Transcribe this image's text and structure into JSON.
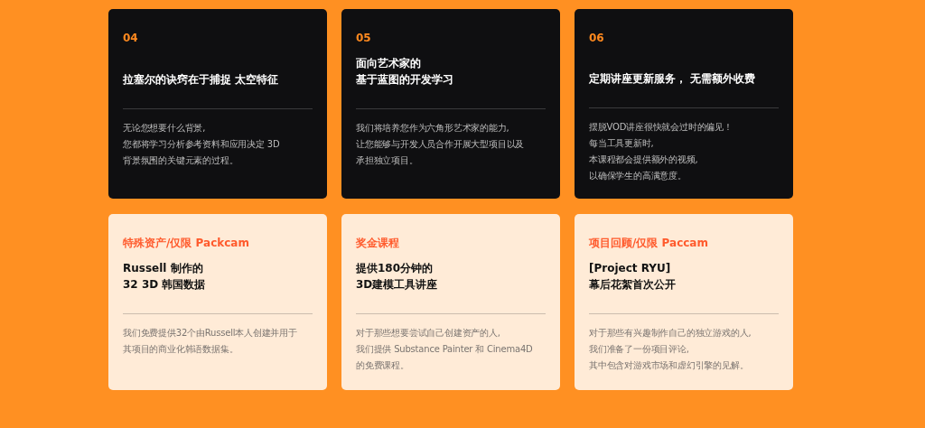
{
  "cards": [
    {
      "kind": "dark",
      "label": "04",
      "title": [
        "拉塞尔的诀窍在于捕捉 太空特征"
      ],
      "description": [
        "无论您想要什么背景,",
        "您都将学习分析参考资料和应用决定 3D",
        "背景氛围的关键元素的过程。"
      ]
    },
    {
      "kind": "dark",
      "label": "05",
      "title": [
        "面向艺术家的",
        "基于蓝图的开发学习"
      ],
      "description": [
        "我们将培养您作为六角形艺术家的能力,",
        "让您能够与开发人员合作开展大型项目以及",
        "承担独立项目。"
      ]
    },
    {
      "kind": "dark",
      "label": "06",
      "title": [
        "定期讲座更新服务， 无需额外收费"
      ],
      "description": [
        "摆脱VOD讲座很快就会过时的偏见！",
        "每当工具更新时,",
        "本课程都会提供额外的视频,",
        "以确保学生的高满意度。"
      ]
    },
    {
      "kind": "light",
      "label": "特殊资产/仅限 Packcam",
      "title": [
        "Russell 制作的",
        "32 3D 韩国数据"
      ],
      "description": [
        "我们免费提供32个由Russell本人创建并用于",
        "其项目的商业化韩语数据集。"
      ]
    },
    {
      "kind": "light",
      "label": "奖金课程",
      "title": [
        "提供180分钟的",
        "3D建模工具讲座"
      ],
      "description": [
        "对于那些想要尝试自己创建资产的人,",
        "我们提供 Substance Painter 和 Cinema4D",
        "的免费课程。"
      ]
    },
    {
      "kind": "light",
      "label": "项目回顾/仅限 Paccam",
      "title": [
        "[Project RYU]",
        "幕后花絮首次公开"
      ],
      "description": [
        "对于那些有兴趣制作自己的独立游戏的人,",
        "我们准备了一份项目评论,",
        "其中包含对游戏市场和虚幻引擎的见解。"
      ]
    }
  ]
}
